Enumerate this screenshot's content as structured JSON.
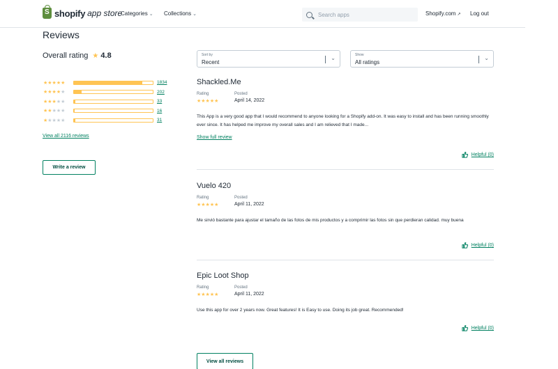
{
  "header": {
    "logo_bold": "shopify",
    "logo_italic": "app store",
    "nav": [
      {
        "label": "Categories"
      },
      {
        "label": "Collections"
      }
    ],
    "search_placeholder": "Search apps",
    "shopify_link": "Shopify.com",
    "logout": "Log out"
  },
  "page_title": "Reviews",
  "overall": {
    "label": "Overall rating",
    "score": "4.8"
  },
  "distribution": [
    {
      "stars": 5,
      "count": "1834",
      "fraction": 0.87
    },
    {
      "stars": 4,
      "count": "202",
      "fraction": 0.1
    },
    {
      "stars": 3,
      "count": "33",
      "fraction": 0.015
    },
    {
      "stars": 2,
      "count": "16",
      "fraction": 0.008
    },
    {
      "stars": 1,
      "count": "31",
      "fraction": 0.014
    }
  ],
  "view_all_link": "View all 2116 reviews",
  "write_review": "Write a review",
  "sort": {
    "label": "Sort by",
    "value": "Recent"
  },
  "show": {
    "label": "Show",
    "value": "All ratings"
  },
  "review_labels": {
    "rating": "Rating",
    "posted": "Posted",
    "show_full": "Show full review",
    "helpful": "Helpful (0)"
  },
  "reviews": [
    {
      "name": "Shackled.Me",
      "date": "April 14, 2022",
      "rating": 5,
      "body": "This App is a very good app that I would recommend to anyone looking for a Shopify add-on. It was easy to install and has been running smoothly ever since. It has helped me improve my overall sales and I am relieved that I made..."
    },
    {
      "name": "Vuelo 420",
      "date": "April 11, 2022",
      "rating": 5,
      "body": "Me sirvió bastante para ajustar el tamaño de las fotos de mis productos y a comprimir las fotos sin que perdieran calidad. muy buena"
    },
    {
      "name": "Epic Loot Shop",
      "date": "April 11, 2022",
      "rating": 5,
      "body": "Use this app for over 2 years now. Great features! It is Easy to use. Doing its job great. Recommended!"
    }
  ],
  "view_all_button": "View all reviews",
  "colors": {
    "accent": "#008060",
    "star": "#ffc453",
    "text": "#212b36"
  }
}
